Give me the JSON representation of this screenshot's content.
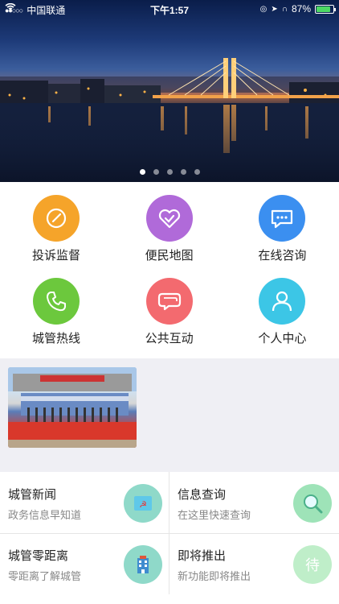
{
  "status_bar": {
    "carrier": "中国联通",
    "time": "下午1:57",
    "battery": "87%",
    "battery_level": 0.87
  },
  "banner": {
    "slide_count": 5,
    "active_slide": 1
  },
  "grid": {
    "items": [
      {
        "label": "投诉监督",
        "icon": "edit-icon",
        "color": "#f5a42a"
      },
      {
        "label": "便民地图",
        "icon": "heart-check-icon",
        "color": "#b06ad9"
      },
      {
        "label": "在线咨询",
        "icon": "chat-bubble-icon",
        "color": "#3b8ff0"
      },
      {
        "label": "城管热线",
        "icon": "phone-icon",
        "color": "#6cc83d"
      },
      {
        "label": "公共互动",
        "icon": "chat-bubbles-icon",
        "color": "#f36a6f"
      },
      {
        "label": "个人中心",
        "icon": "user-icon",
        "color": "#3cc6e6"
      }
    ]
  },
  "cards": [
    {
      "title": "城管新闻",
      "subtitle": "政务信息早知道",
      "icon": "news-icon",
      "color": "#8fd9c9"
    },
    {
      "title": "信息查询",
      "subtitle": "在这里快速查询",
      "icon": "search-icon",
      "color": "#9ee3b8"
    },
    {
      "title": "城管零距离",
      "subtitle": "零距离了解城管",
      "icon": "building-icon",
      "color": "#8fd9c9"
    },
    {
      "title": "即将推出",
      "subtitle": "新功能即将推出",
      "icon": "coming-soon-icon",
      "icon_text": "待",
      "color": "#bfeec9"
    }
  ]
}
